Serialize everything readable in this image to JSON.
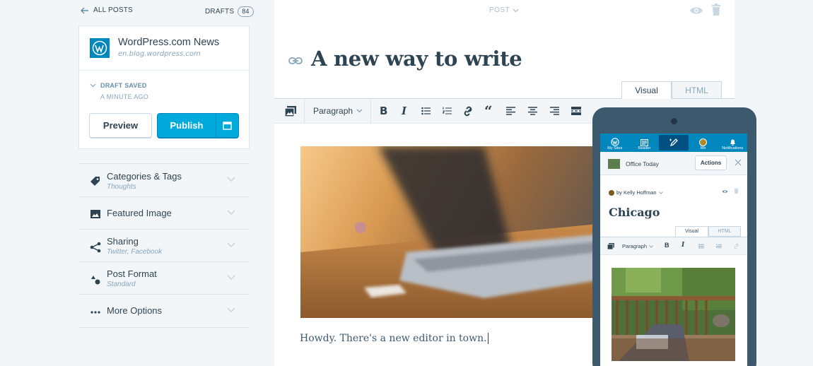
{
  "sidebar": {
    "back_label": "ALL POSTS",
    "drafts_label": "DRAFTS",
    "drafts_count": "84",
    "site_name": "WordPress.com News",
    "site_url": "en.blog.wordpress.com",
    "status": "DRAFT SAVED",
    "status_time": "A MINUTE AGO",
    "preview_label": "Preview",
    "publish_label": "Publish",
    "sections": [
      {
        "title": "Categories & Tags",
        "subtitle": "Thoughts",
        "icon": "tag-icon"
      },
      {
        "title": "Featured Image",
        "subtitle": "",
        "icon": "image-icon"
      },
      {
        "title": "Sharing",
        "subtitle": "Twitter, Facebook",
        "icon": "share-icon"
      },
      {
        "title": "Post Format",
        "subtitle": "Standard",
        "icon": "shapes-icon"
      },
      {
        "title": "More Options",
        "subtitle": "",
        "icon": "ellipsis-icon"
      }
    ]
  },
  "editor": {
    "post_type": "POST",
    "title": "A new way to write",
    "tabs": [
      "Visual",
      "HTML"
    ],
    "toolbar": {
      "format": "Paragraph"
    },
    "body": "Howdy. There's a new editor in town."
  },
  "mobile": {
    "nav": [
      "My Sites",
      "Reader",
      "",
      "Me",
      "Notifications"
    ],
    "site_name": "Office Today",
    "actions_label": "Actions",
    "byline": "by Kelly Hoffman",
    "title": "Chicago",
    "tabs": [
      "Visual",
      "HTML"
    ],
    "format": "Paragraph"
  },
  "colors": {
    "accent": "#00aadc",
    "brand": "#0087be",
    "text": "#2e4453",
    "muted": "#87a6bc",
    "background": "#f3f6f8"
  }
}
